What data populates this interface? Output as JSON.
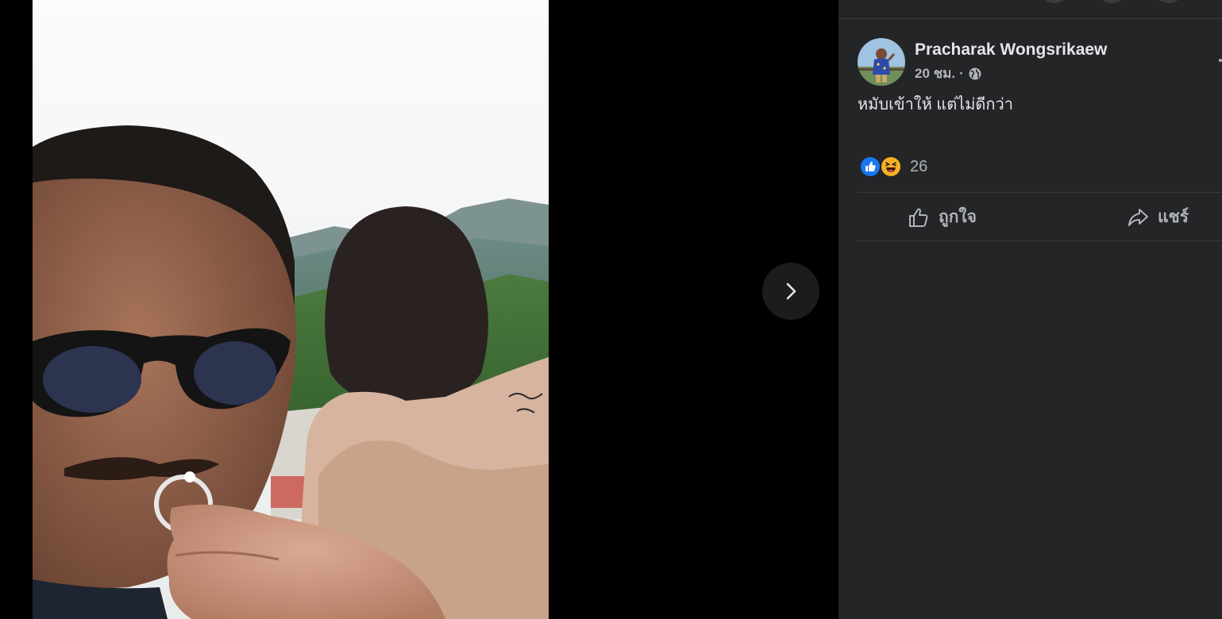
{
  "viewer": {
    "photo_icon": "photo",
    "next_icon": "chevron-right-icon"
  },
  "post": {
    "author": "Pracharak Wongsrikaew",
    "time": "20 ชม.",
    "separator": "·",
    "privacy_icon": "globe-icon",
    "text": "หมับเข้าให้ แต่ไม่ดีกว่า",
    "reactions": {
      "icons": [
        "like-reaction-icon",
        "haha-reaction-icon"
      ],
      "count": "26"
    },
    "actions": {
      "like_label": "ถูกใจ",
      "share_label": "แชร์"
    }
  },
  "colors": {
    "panel_bg": "#242526",
    "primary_text": "#e4e6eb",
    "secondary_text": "#b0b3b8",
    "like_blue": "#1877f2",
    "haha_yellow": "#f7b125"
  }
}
